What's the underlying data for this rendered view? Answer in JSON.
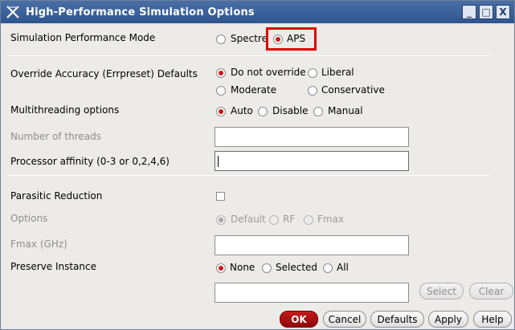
{
  "window": {
    "title": "High-Performance Simulation Options",
    "controls": [
      "_",
      "□",
      "X"
    ]
  },
  "sim_mode": {
    "label": "Simulation Performance Mode",
    "options": [
      "Spectre",
      "APS"
    ],
    "selected": "APS"
  },
  "override_accuracy": {
    "label": "Override Accuracy (Errpreset) Defaults",
    "options": [
      "Do not override",
      "Liberal",
      "Moderate",
      "Conservative"
    ],
    "selected": "Do not override"
  },
  "multithreading": {
    "label": "Multithreading options",
    "options": [
      "Auto",
      "Disable",
      "Manual"
    ],
    "selected": "Auto"
  },
  "threads": {
    "label": "Number of threads",
    "value": ""
  },
  "processor_affinity": {
    "label": "Processor affinity (0-3 or 0,2,4,6)",
    "value": ""
  },
  "parasitic_reduction": {
    "label": "Parasitic Reduction",
    "checked": false
  },
  "options": {
    "label": "Options",
    "choices": [
      "Default",
      "RF",
      "Fmax"
    ],
    "selected": "Default"
  },
  "fmax": {
    "label": "Fmax (GHz)",
    "value": ""
  },
  "preserve_instance": {
    "label": "Preserve Instance",
    "options": [
      "None",
      "Selected",
      "All"
    ],
    "selected": "None",
    "value": ""
  },
  "side_buttons": {
    "select": "Select",
    "clear": "Clear"
  },
  "bottom_buttons": {
    "ok": "OK",
    "cancel": "Cancel",
    "defaults": "Defaults",
    "apply": "Apply",
    "help": "Help"
  },
  "colors": {
    "title_bar": "#2f5590",
    "radio_selected": "#d11717",
    "highlight": "#e00000",
    "ok_button": "#b51313"
  }
}
